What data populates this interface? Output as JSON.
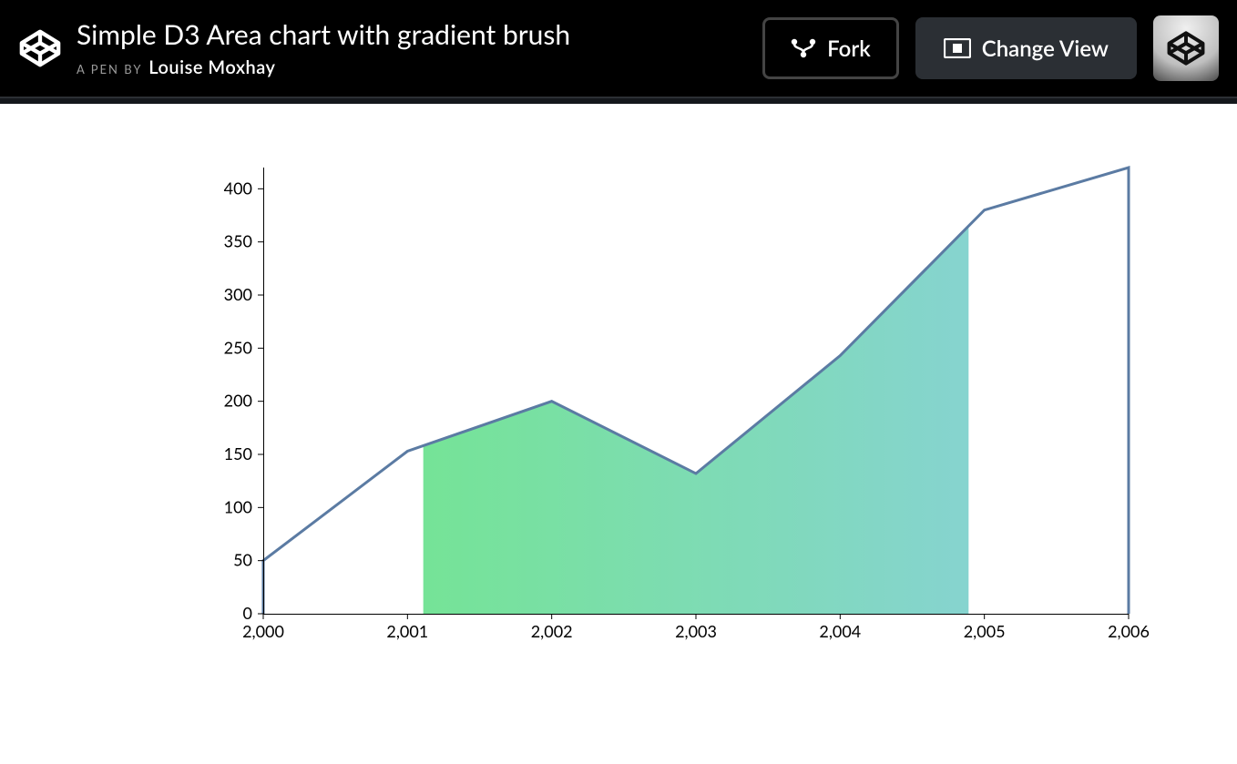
{
  "header": {
    "title": "Simple D3 Area chart with gradient brush",
    "byline_prefix": "A PEN BY",
    "author": "Louise Moxhay",
    "fork_label": "Fork",
    "changeview_label": "Change View"
  },
  "chart_data": {
    "type": "area",
    "x": [
      2000,
      2001,
      2002,
      2003,
      2004,
      2005,
      2006
    ],
    "values": [
      50,
      153,
      200,
      132,
      243,
      380,
      420
    ],
    "xlabel": "",
    "ylabel": "",
    "ylim": [
      0,
      420
    ],
    "xlim": [
      2000,
      2006
    ],
    "y_ticks": [
      0,
      50,
      100,
      150,
      200,
      250,
      300,
      350,
      400
    ],
    "x_ticks": [
      2000,
      2001,
      2002,
      2003,
      2004,
      2005,
      2006
    ],
    "x_tick_labels": [
      "2,000",
      "2,001",
      "2,002",
      "2,003",
      "2,004",
      "2,005",
      "2,006"
    ],
    "brush_extent": [
      2001.1,
      2004.9
    ],
    "gradient": {
      "start": "#70e886",
      "end": "#8bcfe0"
    },
    "line_color": "#5b7ba3",
    "title": ""
  }
}
